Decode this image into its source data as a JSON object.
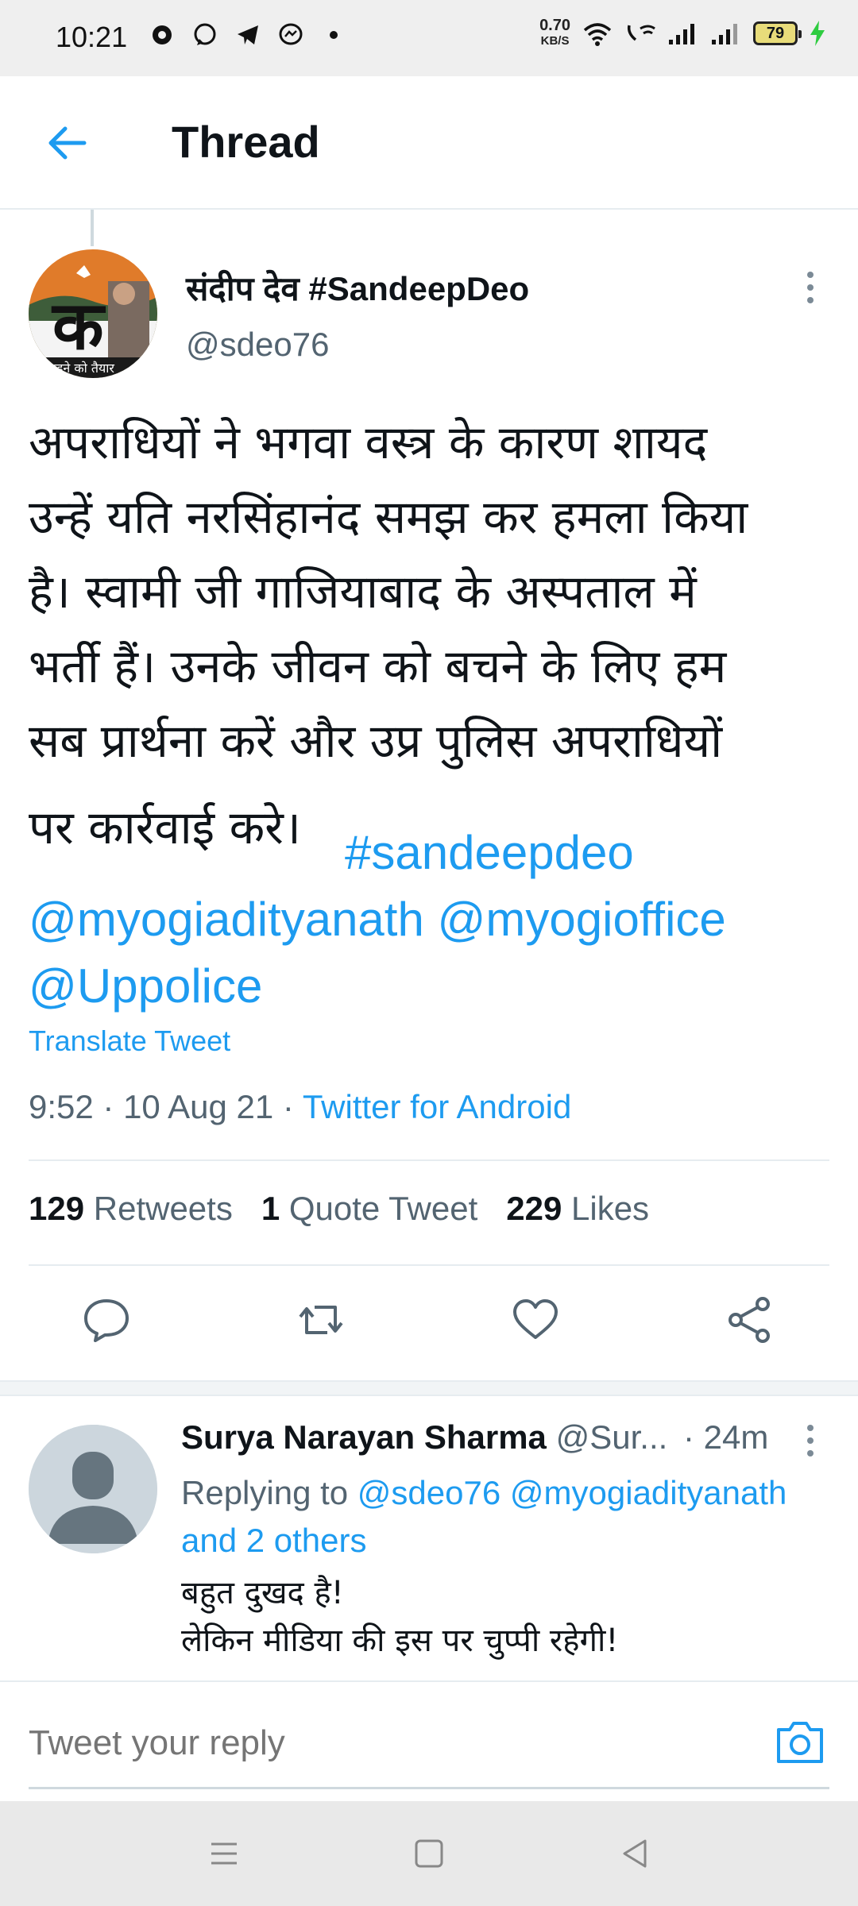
{
  "status_bar": {
    "time": "10:21",
    "net_speed_value": "0.70",
    "net_speed_unit": "KB/S",
    "battery": "79"
  },
  "header": {
    "title": "Thread"
  },
  "main_tweet": {
    "author_name": "संदीप देव #SandeepDeo",
    "author_handle": "@sdeo76",
    "avatar_text": "क",
    "avatar_tagline": "लड़ने को तैयार",
    "text_line1": "अपराधियों ने भगवा वस्त्र के कारण शायद",
    "text_line2": "उन्हें यति नरसिंहानंद समझ कर हमला किया",
    "text_line3": "है। स्वामी जी गाजियाबाद के अस्पताल में",
    "text_line4": "भर्ती हैं। उनके जीवन को बचने के लिए हम",
    "text_line5": "सब प्रार्थना करें और उप्र पुलिस अपराधियों",
    "text_line6": "पर कार्रवाई करे।",
    "hashtag": "#sandeepdeo",
    "mention1": "@myogiadityanath",
    "mention2": "@myogioffice",
    "mention3": "@Uppolice",
    "translate": "Translate Tweet",
    "time_date": "9:52 · 10 Aug 21 · ",
    "source": "Twitter for Android",
    "retweets_count": "129",
    "retweets_label": "Retweets",
    "quote_count": "1",
    "quote_label": "Quote Tweet",
    "likes_count": "229",
    "likes_label": "Likes"
  },
  "reply": {
    "name": "Surya Narayan Sharma",
    "handle": "@Sur...",
    "time": "· 24m",
    "replying_prefix": "Replying to ",
    "replying_links": "@sdeo76 @myogiadityanath",
    "replying_others": "and 2 others",
    "text_line1": "बहुत दुखद है!",
    "text_line2": "लेकिन मीडिया की इस पर चुप्पी रहेगी!"
  },
  "composer": {
    "placeholder": "Tweet your reply"
  },
  "icons": {
    "back": "arrow-left-icon",
    "more": "more-vertical-icon",
    "reply": "comment-icon",
    "retweet": "retweet-icon",
    "like": "heart-icon",
    "share": "share-icon",
    "camera": "camera-icon"
  },
  "colors": {
    "accent": "#1d9bf0",
    "text": "#0f1419",
    "secondary": "#536471"
  }
}
